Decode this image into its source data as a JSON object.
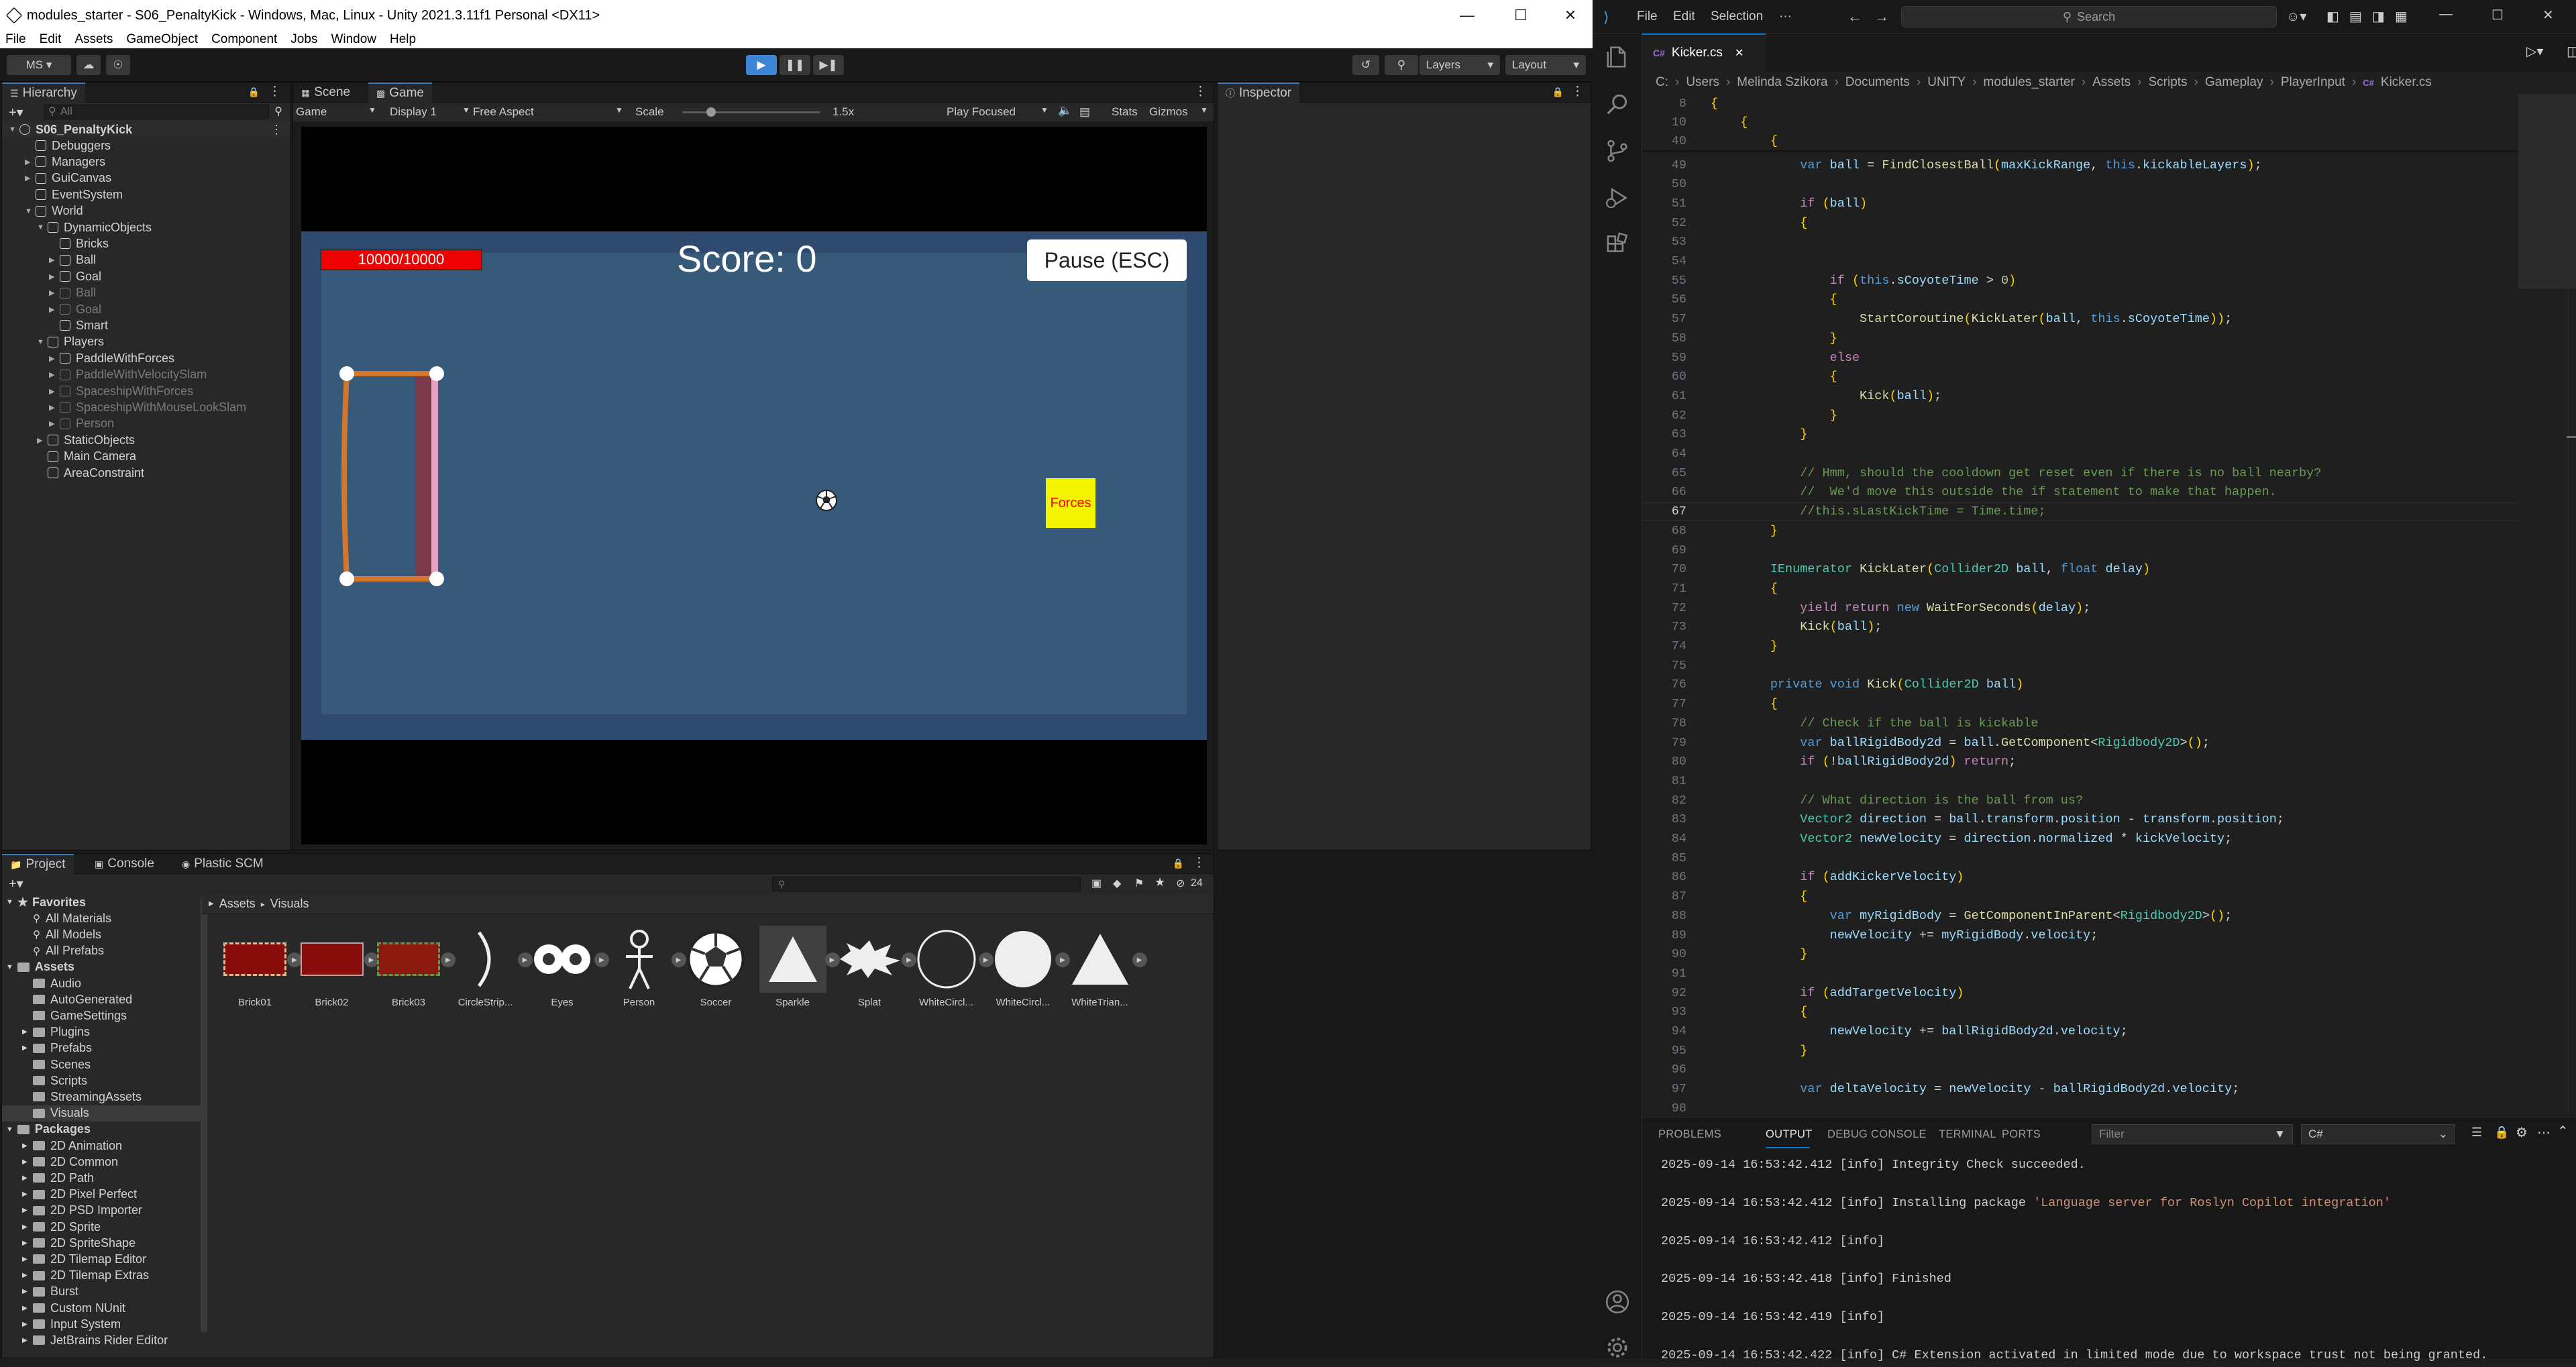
{
  "unity": {
    "window_title": "modules_starter - S06_PenaltyKick - Windows, Mac, Linux - Unity 2021.3.11f1 Personal <DX11>",
    "menu": [
      "File",
      "Edit",
      "Assets",
      "GameObject",
      "Component",
      "Jobs",
      "Window",
      "Help"
    ],
    "toolbar": {
      "account": "MS ▾",
      "layers": "Layers",
      "layout": "Layout"
    },
    "hierarchy": {
      "tab": "Hierarchy",
      "search_placeholder": "All",
      "scene": "S06_PenaltyKick",
      "items": [
        {
          "label": "Debuggers"
        },
        {
          "label": "Managers"
        },
        {
          "label": "GuiCanvas"
        },
        {
          "label": "EventSystem"
        },
        {
          "label": "World"
        },
        {
          "label": "DynamicObjects"
        },
        {
          "label": "Bricks"
        },
        {
          "label": "Ball"
        },
        {
          "label": "Goal"
        },
        {
          "label": "Ball"
        },
        {
          "label": "Goal"
        },
        {
          "label": "Smart"
        },
        {
          "label": "Players"
        },
        {
          "label": "PaddleWithForces"
        },
        {
          "label": "PaddleWithVelocitySlam"
        },
        {
          "label": "SpaceshipWithForces"
        },
        {
          "label": "SpaceshipWithMouseLookSlam"
        },
        {
          "label": "Person"
        },
        {
          "label": "StaticObjects"
        },
        {
          "label": "Main Camera"
        },
        {
          "label": "AreaConstraint"
        }
      ]
    },
    "scene_tab": "Scene",
    "game_tab": "Game",
    "game_toolbar": {
      "mode": "Game",
      "display": "Display 1",
      "aspect": "Free Aspect",
      "scale_label": "Scale",
      "scale_value": "1.5x",
      "play_mode": "Play Focused",
      "stats": "Stats",
      "gizmos": "Gizmos"
    },
    "game": {
      "health": "10000/10000",
      "score": "Score: 0",
      "pause": "Pause (ESC)",
      "forces": "Forces"
    },
    "inspector_tab": "Inspector",
    "project_tabs": [
      "Project",
      "Console",
      "Plastic SCM"
    ],
    "project_count": "24",
    "favorites": {
      "label": "Favorites",
      "items": [
        "All Materials",
        "All Models",
        "All Prefabs"
      ]
    },
    "assets": {
      "label": "Assets",
      "items": [
        "Audio",
        "AutoGenerated",
        "GameSettings",
        "Plugins",
        "Prefabs",
        "Scenes",
        "Scripts",
        "StreamingAssets",
        "Visuals"
      ]
    },
    "packages": {
      "label": "Packages",
      "items": [
        "2D Animation",
        "2D Common",
        "2D Path",
        "2D Pixel Perfect",
        "2D PSD Importer",
        "2D Sprite",
        "2D SpriteShape",
        "2D Tilemap Editor",
        "2D Tilemap Extras",
        "Burst",
        "Custom NUnit",
        "Input System",
        "JetBrains Rider Editor"
      ]
    },
    "breadcrumb": [
      "Assets",
      "Visuals"
    ],
    "visuals": [
      "Brick01",
      "Brick02",
      "Brick03",
      "CircleStrip...",
      "Eyes",
      "Person",
      "Soccer",
      "Sparkle",
      "Splat",
      "WhiteCircl...",
      "WhiteCircl...",
      "WhiteTrian..."
    ]
  },
  "vscode": {
    "menu": [
      "File",
      "Edit",
      "Selection",
      "···"
    ],
    "search": "Search",
    "tab": "Kicker.cs",
    "breadcrumb": [
      "C:",
      "Users",
      "Melinda Szikora",
      "Documents",
      "UNITY",
      "modules_starter",
      "Assets",
      "Scripts",
      "Gameplay",
      "PlayerInput",
      "Kicker.cs"
    ],
    "sticky": [
      {
        "n": "8",
        "code": "{"
      },
      {
        "n": "10",
        "code": "    {"
      },
      {
        "n": "40",
        "code": "        {"
      }
    ],
    "code": [
      {
        "n": "49",
        "code": "            var ball = FindClosestBall(maxKickRange, this.kickableLayers);"
      },
      {
        "n": "50",
        "code": ""
      },
      {
        "n": "51",
        "code": "            if (ball)"
      },
      {
        "n": "52",
        "code": "            {"
      },
      {
        "n": "53",
        "code": ""
      },
      {
        "n": "54",
        "code": ""
      },
      {
        "n": "55",
        "code": "                if (this.sCoyoteTime > 0)"
      },
      {
        "n": "56",
        "code": "                {"
      },
      {
        "n": "57",
        "code": "                    StartCoroutine(KickLater(ball, this.sCoyoteTime));"
      },
      {
        "n": "58",
        "code": "                }"
      },
      {
        "n": "59",
        "code": "                else"
      },
      {
        "n": "60",
        "code": "                {"
      },
      {
        "n": "61",
        "code": "                    Kick(ball);"
      },
      {
        "n": "62",
        "code": "                }"
      },
      {
        "n": "63",
        "code": "            }"
      },
      {
        "n": "64",
        "code": ""
      },
      {
        "n": "65",
        "code": "            // Hmm, should the cooldown get reset even if there is no ball nearby?"
      },
      {
        "n": "66",
        "code": "            //  We'd move this outside the if statement to make that happen."
      },
      {
        "n": "67",
        "code": "            //this.sLastKickTime = Time.time;"
      },
      {
        "n": "68",
        "code": "        }"
      },
      {
        "n": "69",
        "code": ""
      },
      {
        "n": "70",
        "code": "        IEnumerator KickLater(Collider2D ball, float delay)"
      },
      {
        "n": "71",
        "code": "        {"
      },
      {
        "n": "72",
        "code": "            yield return new WaitForSeconds(delay);"
      },
      {
        "n": "73",
        "code": "            Kick(ball);"
      },
      {
        "n": "74",
        "code": "        }"
      },
      {
        "n": "75",
        "code": ""
      },
      {
        "n": "76",
        "code": "        private void Kick(Collider2D ball)"
      },
      {
        "n": "77",
        "code": "        {"
      },
      {
        "n": "78",
        "code": "            // Check if the ball is kickable"
      },
      {
        "n": "79",
        "code": "            var ballRigidBody2d = ball.GetComponent<Rigidbody2D>();"
      },
      {
        "n": "80",
        "code": "            if (!ballRigidBody2d) return;"
      },
      {
        "n": "81",
        "code": ""
      },
      {
        "n": "82",
        "code": "            // What direction is the ball from us?"
      },
      {
        "n": "83",
        "code": "            Vector2 direction = ball.transform.position - transform.position;"
      },
      {
        "n": "84",
        "code": "            Vector2 newVelocity = direction.normalized * kickVelocity;"
      },
      {
        "n": "85",
        "code": ""
      },
      {
        "n": "86",
        "code": "            if (addKickerVelocity)"
      },
      {
        "n": "87",
        "code": "            {"
      },
      {
        "n": "88",
        "code": "                var myRigidBody = GetComponentInParent<Rigidbody2D>();"
      },
      {
        "n": "89",
        "code": "                newVelocity += myRigidBody.velocity;"
      },
      {
        "n": "90",
        "code": "            }"
      },
      {
        "n": "91",
        "code": ""
      },
      {
        "n": "92",
        "code": "            if (addTargetVelocity)"
      },
      {
        "n": "93",
        "code": "            {"
      },
      {
        "n": "94",
        "code": "                newVelocity += ballRigidBody2d.velocity;"
      },
      {
        "n": "95",
        "code": "            }"
      },
      {
        "n": "96",
        "code": ""
      },
      {
        "n": "97",
        "code": "            var deltaVelocity = newVelocity - ballRigidBody2d.velocity;"
      },
      {
        "n": "98",
        "code": ""
      }
    ],
    "current_line": "67",
    "panel_tabs": [
      "PROBLEMS",
      "OUTPUT",
      "DEBUG CONSOLE",
      "TERMINAL",
      "PORTS"
    ],
    "filter_placeholder": "Filter",
    "output_channel": "C#",
    "output": [
      "2025-09-14 16:53:42.412 [info] Integrity Check succeeded.",
      "",
      "2025-09-14 16:53:42.412 [info] Installing package 'Language server for Roslyn Copilot integration'",
      "",
      "2025-09-14 16:53:42.412 [info]",
      "",
      "2025-09-14 16:53:42.418 [info] Finished",
      "",
      "2025-09-14 16:53:42.419 [info]",
      "",
      "2025-09-14 16:53:42.422 [info] C# Extension activated in limited mode due to workspace trust not being granted."
    ]
  }
}
